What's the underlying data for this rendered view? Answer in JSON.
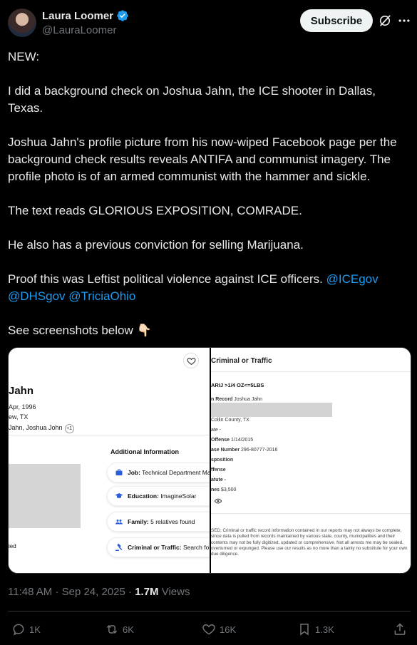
{
  "author": {
    "display_name": "Laura Loomer",
    "handle": "@LauraLoomer",
    "verified": true,
    "verified_color": "#1d9bf0"
  },
  "header": {
    "subscribe_label": "Subscribe",
    "grok_icon": "grok-icon",
    "more_icon": "more-icon"
  },
  "tweet": {
    "line1": "NEW:",
    "line2": "I did a background check on Joshua Jahn, the ICE shooter in Dallas, Texas.",
    "line3": "Joshua Jahn's profile picture from his now-wiped Facebook page per the background check results reveals ANTIFA and communist imagery. The profile photo is of an armed communist with the hammer and sickle.",
    "line4": "The text reads GLORIOUS EXPOSITION, COMRADE.",
    "line5": "He also has a previous conviction for selling Marijuana.",
    "line6_text": "Proof this was Leftist political violence against ICE officers. ",
    "mentions": [
      "@ICEgov",
      "@DHSgov",
      "@TriciaOhio"
    ],
    "line7": "See screenshots below",
    "line7_emoji": "👇🏻"
  },
  "media": {
    "left": {
      "name": "Jahn",
      "dob": "Apr, 1996",
      "location": "ew, TX",
      "aka": "Jahn, Joshua John",
      "aka_more": "+1",
      "additional_info_title": "Additional Information",
      "chips": [
        {
          "icon": "briefcase-icon",
          "label": "Job:",
          "value": "Technical Department Mana"
        },
        {
          "icon": "graduation-cap-icon",
          "label": "Education:",
          "value": "ImagineSolar"
        },
        {
          "icon": "people-icon",
          "label": "Family:",
          "value": "5 relatives found"
        },
        {
          "icon": "gavel-icon",
          "label": "Criminal or Traffic:",
          "value": "Search fo"
        }
      ],
      "died": "ied"
    },
    "right": {
      "title": "Criminal or Traffic",
      "offense": "ARIJ >1/4 OZ<=5LBS",
      "name_on_record_label": "n Record",
      "name_on_record_value": "Joshua Jahn",
      "county": "Collin County, TX",
      "state_label": "ate -",
      "offense_date_label": "Offense",
      "offense_date_value": "1/14/2015",
      "case_number_label": "ase Number",
      "case_number_value": "296-80777-2016",
      "disposition_label": "sposition",
      "offense_label": "ffense",
      "statute_label": "atute -",
      "fines_label": "nes",
      "fines_value": "$3,500",
      "disclaimer": "SED: Criminal or traffic record information contained in our reports may not always be complete, since data is pulled from records maintained by various state, county, municipalities and their contents may not be fully digitized, updated or comprehensive. Not all arrests me may be sealed, overturned or expunged. Please use our results as no more than a tainly no substitute for your own due diligence."
    }
  },
  "meta": {
    "time": "11:48 AM",
    "date": "Sep 24, 2025",
    "separator": "·",
    "views_count": "1.7M",
    "views_label": "Views"
  },
  "actions": {
    "reply": "1K",
    "repost": "6K",
    "like": "16K",
    "bookmark": "1.3K"
  },
  "colors": {
    "background": "#000000",
    "text": "#e7e9ea",
    "muted": "#71767b",
    "link": "#1d9bf0",
    "chip_icon": "#2b5dd8"
  }
}
